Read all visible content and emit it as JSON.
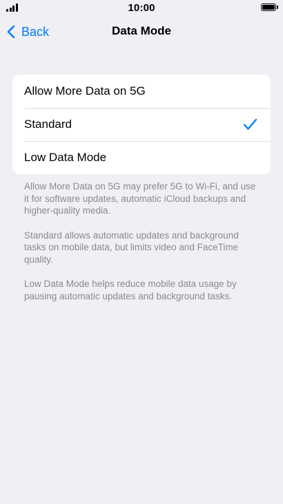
{
  "status_bar": {
    "time": "10:00"
  },
  "nav": {
    "back_label": "Back",
    "title": "Data Mode"
  },
  "options": [
    {
      "label": "Allow More Data on 5G",
      "selected": false
    },
    {
      "label": "Standard",
      "selected": true
    },
    {
      "label": "Low Data Mode",
      "selected": false
    }
  ],
  "footer_notes": [
    "Allow More Data on 5G may prefer 5G to Wi-Fi, and use it for software updates, automatic iCloud backups and higher-quality media.",
    "Standard allows automatic updates and background tasks on mobile data, but limits video and FaceTime quality.",
    "Low Data Mode helps reduce mobile data usage by pausing automatic updates and background tasks."
  ],
  "colors": {
    "accent": "#007aff",
    "background": "#efeff4",
    "footer_text": "#8a8a8e"
  },
  "icons": {
    "signal": "cellular-signal-icon",
    "battery": "battery-icon",
    "back": "chevron-left-icon",
    "selected": "checkmark-icon"
  }
}
